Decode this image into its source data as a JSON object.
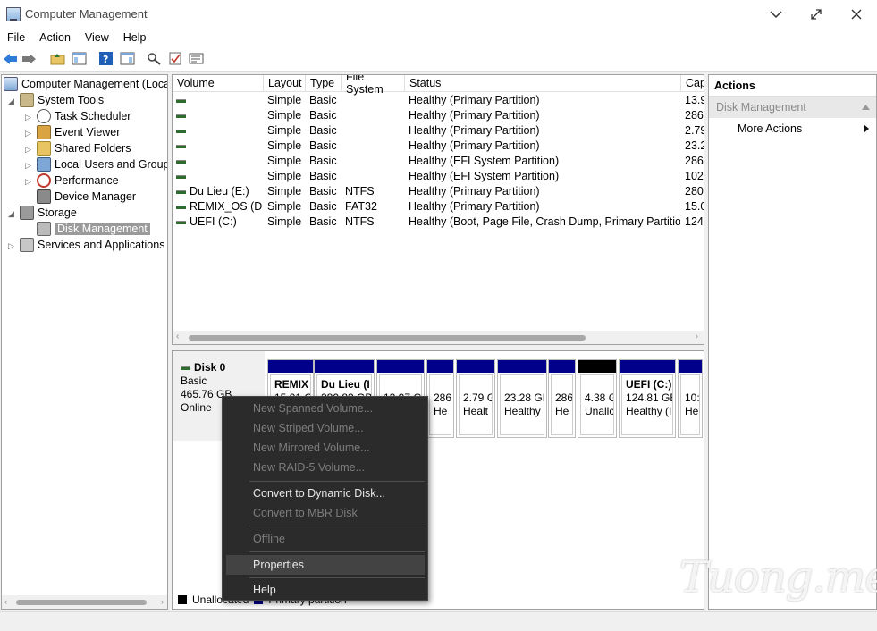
{
  "window": {
    "title": "Computer Management"
  },
  "menu": [
    "File",
    "Action",
    "View",
    "Help"
  ],
  "tree": {
    "root": "Computer Management (Local",
    "system_tools": "System Tools",
    "task_scheduler": "Task Scheduler",
    "event_viewer": "Event Viewer",
    "shared_folders": "Shared Folders",
    "local_users": "Local Users and Groups",
    "performance": "Performance",
    "device_manager": "Device Manager",
    "storage": "Storage",
    "disk_management": "Disk Management",
    "services": "Services and Applications"
  },
  "volume_list": {
    "columns": [
      "Volume",
      "Layout",
      "Type",
      "File System",
      "Status",
      "Cap"
    ],
    "rows": [
      {
        "volume": "",
        "layout": "Simple",
        "type": "Basic",
        "fs": "",
        "status": "Healthy (Primary Partition)",
        "cap": "13.9"
      },
      {
        "volume": "",
        "layout": "Simple",
        "type": "Basic",
        "fs": "",
        "status": "Healthy (Primary Partition)",
        "cap": "286"
      },
      {
        "volume": "",
        "layout": "Simple",
        "type": "Basic",
        "fs": "",
        "status": "Healthy (Primary Partition)",
        "cap": "2.79"
      },
      {
        "volume": "",
        "layout": "Simple",
        "type": "Basic",
        "fs": "",
        "status": "Healthy (Primary Partition)",
        "cap": "23.2"
      },
      {
        "volume": "",
        "layout": "Simple",
        "type": "Basic",
        "fs": "",
        "status": "Healthy (EFI System Partition)",
        "cap": "286"
      },
      {
        "volume": "",
        "layout": "Simple",
        "type": "Basic",
        "fs": "",
        "status": "Healthy (EFI System Partition)",
        "cap": "102"
      },
      {
        "volume": "Du Lieu (E:)",
        "layout": "Simple",
        "type": "Basic",
        "fs": "NTFS",
        "status": "Healthy (Primary Partition)",
        "cap": "280."
      },
      {
        "volume": "REMIX_OS (D:)",
        "layout": "Simple",
        "type": "Basic",
        "fs": "FAT32",
        "status": "Healthy (Primary Partition)",
        "cap": "15.0"
      },
      {
        "volume": "UEFI (C:)",
        "layout": "Simple",
        "type": "Basic",
        "fs": "NTFS",
        "status": "Healthy (Boot, Page File, Crash Dump, Primary Partition)",
        "cap": "124."
      }
    ]
  },
  "disk": {
    "name": "Disk 0",
    "type": "Basic",
    "size": "465.76 GB",
    "state": "Online",
    "partitions": [
      {
        "l1": "REMIX",
        "l2": "15.01 G",
        "l3": "",
        "bold": true
      },
      {
        "l1": "Du Lieu  (I",
        "l2": "280.83 GB",
        "l3": "",
        "bold": true
      },
      {
        "l1": "",
        "l2": "13.97 G",
        "l3": ""
      },
      {
        "l1": "",
        "l2": "286",
        "l3": "He"
      },
      {
        "l1": "",
        "l2": "2.79 G",
        "l3": "Healt"
      },
      {
        "l1": "",
        "l2": "23.28 GE",
        "l3": "Healthy"
      },
      {
        "l1": "",
        "l2": "286",
        "l3": "He"
      },
      {
        "l1": "",
        "l2": "4.38 G",
        "l3": "Unallc",
        "unallocated": true
      },
      {
        "l1": "UEFI  (C:)",
        "l2": "124.81 GB",
        "l3": "Healthy (I",
        "bold": true
      },
      {
        "l1": "",
        "l2": "10:",
        "l3": "He"
      }
    ]
  },
  "legend": {
    "unallocated": "Unallocated",
    "primary": "Primary partition"
  },
  "actions": {
    "header": "Actions",
    "section": "Disk Management",
    "more": "More Actions"
  },
  "context_menu": [
    {
      "label": "New Spanned Volume...",
      "enabled": false
    },
    {
      "label": "New Striped Volume...",
      "enabled": false
    },
    {
      "label": "New Mirrored Volume...",
      "enabled": false
    },
    {
      "label": "New RAID-5 Volume...",
      "enabled": false
    },
    {
      "label": "Convert to Dynamic Disk...",
      "enabled": true
    },
    {
      "label": "Convert to MBR Disk",
      "enabled": false
    },
    {
      "label": "Offline",
      "enabled": false
    },
    {
      "label": "Properties",
      "enabled": true
    },
    {
      "label": "Help",
      "enabled": true
    }
  ],
  "watermark": "Tuong.me",
  "colors": {
    "primary_partition": "#00008b",
    "unallocated": "#000000",
    "menu_bg": "#2b2b2b",
    "selection": "#9a9a9a"
  }
}
